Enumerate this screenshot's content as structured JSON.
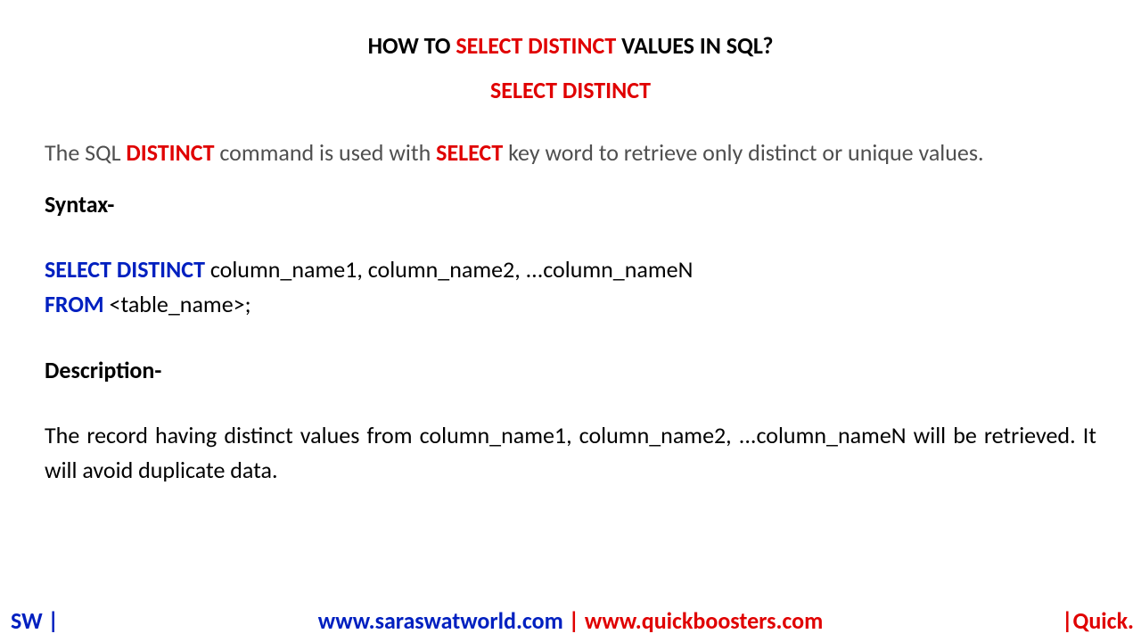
{
  "title": {
    "prefix": "HOW TO ",
    "highlight": "SELECT DISTINCT",
    "suffix": " VALUES IN SQL?"
  },
  "subtitle": "SELECT DISTINCT",
  "intro": {
    "part1": "The SQL ",
    "kw1": "DISTINCT",
    "part2": " command is used with ",
    "kw2": "SELECT",
    "part3": " key word to retrieve only distinct or unique values."
  },
  "syntax_label": "Syntax-",
  "syntax": {
    "kw1": "SELECT DISTINCT",
    "line1_rest": " column_name1, column_name2, ...column_nameN",
    "kw2": "FROM",
    "line2_rest": " <table_name>;"
  },
  "description_label": "Description-",
  "description_text": "The record having distinct values from column_name1, column_name2, ...column_nameN will be retrieved. It will avoid duplicate data.",
  "footer": {
    "left": "SW |",
    "url1": "www.saraswatworld.com",
    "separator": " | ",
    "url2": "www.quickboosters.com",
    "right": "|Quick."
  }
}
